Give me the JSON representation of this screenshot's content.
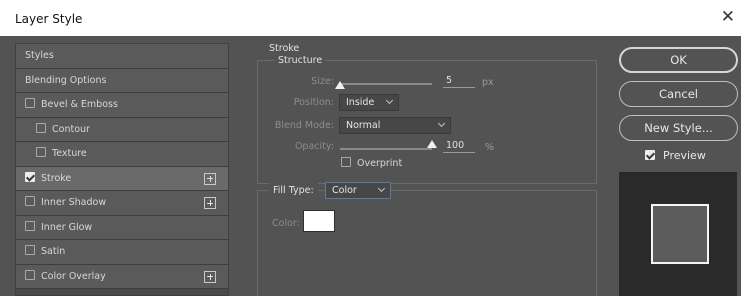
{
  "window": {
    "title": "Layer Style",
    "close_glyph": "✕"
  },
  "styles": [
    {
      "label": "Styles",
      "checkbox": false,
      "checked": false,
      "indent": false,
      "plus": false,
      "selected": false
    },
    {
      "label": "Blending Options",
      "checkbox": false,
      "checked": false,
      "indent": false,
      "plus": false,
      "selected": false
    },
    {
      "label": "Bevel & Emboss",
      "checkbox": true,
      "checked": false,
      "indent": false,
      "plus": false,
      "selected": false
    },
    {
      "label": "Contour",
      "checkbox": true,
      "checked": false,
      "indent": true,
      "plus": false,
      "selected": false
    },
    {
      "label": "Texture",
      "checkbox": true,
      "checked": false,
      "indent": true,
      "plus": false,
      "selected": false
    },
    {
      "label": "Stroke",
      "checkbox": true,
      "checked": true,
      "indent": false,
      "plus": true,
      "selected": true
    },
    {
      "label": "Inner Shadow",
      "checkbox": true,
      "checked": false,
      "indent": false,
      "plus": true,
      "selected": false
    },
    {
      "label": "Inner Glow",
      "checkbox": true,
      "checked": false,
      "indent": false,
      "plus": false,
      "selected": false
    },
    {
      "label": "Satin",
      "checkbox": true,
      "checked": false,
      "indent": false,
      "plus": false,
      "selected": false
    },
    {
      "label": "Color Overlay",
      "checkbox": true,
      "checked": false,
      "indent": false,
      "plus": true,
      "selected": false
    }
  ],
  "stroke": {
    "section_title": "Stroke",
    "structure_title": "Structure",
    "size_label": "Size:",
    "size_value": "5",
    "size_unit": "px",
    "position_label": "Position:",
    "position_value": "Inside",
    "blend_mode_label": "Blend Mode:",
    "blend_mode_value": "Normal",
    "opacity_label": "Opacity:",
    "opacity_value": "100",
    "opacity_unit": "%",
    "overprint_label": "Overprint",
    "overprint_checked": false,
    "fill_type_label": "Fill Type:",
    "fill_type_value": "Color",
    "color_label": "Color:",
    "color_value": "#ffffff"
  },
  "buttons": {
    "ok": "OK",
    "cancel": "Cancel",
    "new_style": "New Style..."
  },
  "preview": {
    "label": "Preview",
    "checked": true
  },
  "colors": {
    "dialog_bg": "#535353",
    "list_item_bg": "#5a5a5a",
    "selected_item_bg": "#6a6a6a",
    "preview_bg": "#2a2a2a",
    "stroke_color": "#ffffff"
  }
}
